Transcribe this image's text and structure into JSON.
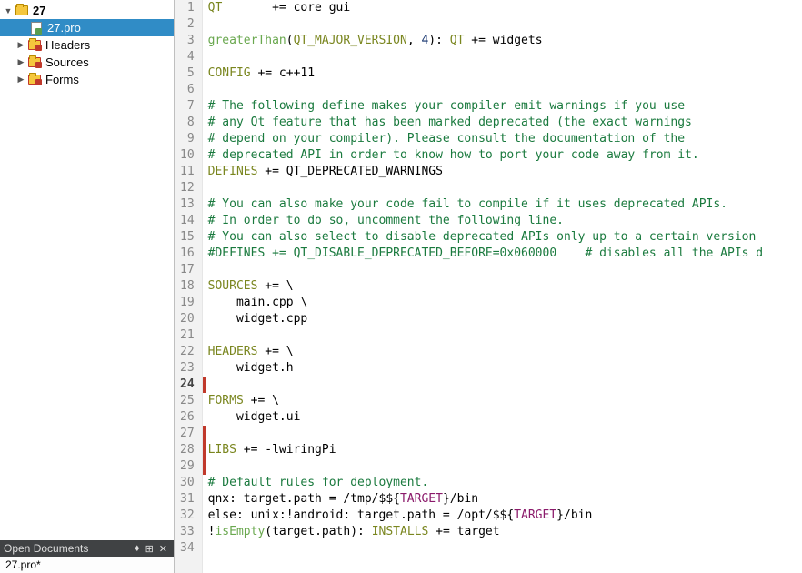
{
  "sidebar": {
    "project": "27",
    "file": "27.pro",
    "folders": [
      "Headers",
      "Sources",
      "Forms"
    ]
  },
  "open_docs": {
    "title": "Open Documents",
    "items": [
      "27.pro*"
    ]
  },
  "editor": {
    "current_line": 24,
    "lines": [
      {
        "n": 1,
        "t": [
          [
            "kw",
            "QT"
          ],
          [
            "txt",
            "       += core gui"
          ]
        ]
      },
      {
        "n": 2,
        "t": []
      },
      {
        "n": 3,
        "t": [
          [
            "fn",
            "greaterThan"
          ],
          [
            "txt",
            "("
          ],
          [
            "kw",
            "QT_MAJOR_VERSION"
          ],
          [
            "txt",
            ", "
          ],
          [
            "num",
            "4"
          ],
          [
            "txt",
            "): "
          ],
          [
            "kw",
            "QT"
          ],
          [
            "txt",
            " += widgets"
          ]
        ]
      },
      {
        "n": 4,
        "t": []
      },
      {
        "n": 5,
        "t": [
          [
            "kw",
            "CONFIG"
          ],
          [
            "txt",
            " += c++11"
          ]
        ]
      },
      {
        "n": 6,
        "t": []
      },
      {
        "n": 7,
        "t": [
          [
            "com",
            "# The following define makes your compiler emit warnings if you use"
          ]
        ]
      },
      {
        "n": 8,
        "t": [
          [
            "com",
            "# any Qt feature that has been marked deprecated (the exact warnings"
          ]
        ]
      },
      {
        "n": 9,
        "t": [
          [
            "com",
            "# depend on your compiler). Please consult the documentation of the"
          ]
        ]
      },
      {
        "n": 10,
        "t": [
          [
            "com",
            "# deprecated API in order to know how to port your code away from it."
          ]
        ]
      },
      {
        "n": 11,
        "t": [
          [
            "kw",
            "DEFINES"
          ],
          [
            "txt",
            " += QT_DEPRECATED_WARNINGS"
          ]
        ]
      },
      {
        "n": 12,
        "t": []
      },
      {
        "n": 13,
        "t": [
          [
            "com",
            "# You can also make your code fail to compile if it uses deprecated APIs."
          ]
        ]
      },
      {
        "n": 14,
        "t": [
          [
            "com",
            "# In order to do so, uncomment the following line."
          ]
        ]
      },
      {
        "n": 15,
        "t": [
          [
            "com",
            "# You can also select to disable deprecated APIs only up to a certain version "
          ]
        ]
      },
      {
        "n": 16,
        "t": [
          [
            "com",
            "#DEFINES += QT_DISABLE_DEPRECATED_BEFORE=0x060000    # disables all the APIs d"
          ]
        ]
      },
      {
        "n": 17,
        "t": []
      },
      {
        "n": 18,
        "t": [
          [
            "kw",
            "SOURCES"
          ],
          [
            "txt",
            " += \\"
          ]
        ]
      },
      {
        "n": 19,
        "t": [
          [
            "txt",
            "    main.cpp \\"
          ]
        ]
      },
      {
        "n": 20,
        "t": [
          [
            "txt",
            "    widget.cpp"
          ]
        ]
      },
      {
        "n": 21,
        "t": []
      },
      {
        "n": 22,
        "t": [
          [
            "kw",
            "HEADERS"
          ],
          [
            "txt",
            " += \\"
          ]
        ]
      },
      {
        "n": 23,
        "t": [
          [
            "txt",
            "    widget.h"
          ]
        ]
      },
      {
        "n": 24,
        "t": [
          [
            "txt",
            "    "
          ]
        ],
        "changed": true,
        "cursor": true
      },
      {
        "n": 25,
        "t": [
          [
            "kw",
            "FORMS"
          ],
          [
            "txt",
            " += \\"
          ]
        ]
      },
      {
        "n": 26,
        "t": [
          [
            "txt",
            "    widget.ui"
          ]
        ]
      },
      {
        "n": 27,
        "t": [],
        "changed": true
      },
      {
        "n": 28,
        "t": [
          [
            "kw",
            "LIBS"
          ],
          [
            "txt",
            " += -lwiringPi"
          ]
        ],
        "changed": true
      },
      {
        "n": 29,
        "t": [],
        "changed": true
      },
      {
        "n": 30,
        "t": [
          [
            "com",
            "# Default rules for deployment."
          ]
        ]
      },
      {
        "n": 31,
        "t": [
          [
            "txt",
            "qnx: target.path = /tmp/$${"
          ],
          [
            "tgt",
            "TARGET"
          ],
          [
            "txt",
            "}/bin"
          ]
        ]
      },
      {
        "n": 32,
        "t": [
          [
            "txt",
            "else: unix:!android: target.path = /opt/$${"
          ],
          [
            "tgt",
            "TARGET"
          ],
          [
            "txt",
            "}/bin"
          ]
        ]
      },
      {
        "n": 33,
        "t": [
          [
            "txt",
            "!"
          ],
          [
            "fn",
            "isEmpty"
          ],
          [
            "txt",
            "(target.path): "
          ],
          [
            "kw",
            "INSTALLS"
          ],
          [
            "txt",
            " += target"
          ]
        ]
      },
      {
        "n": 34,
        "t": []
      }
    ]
  }
}
